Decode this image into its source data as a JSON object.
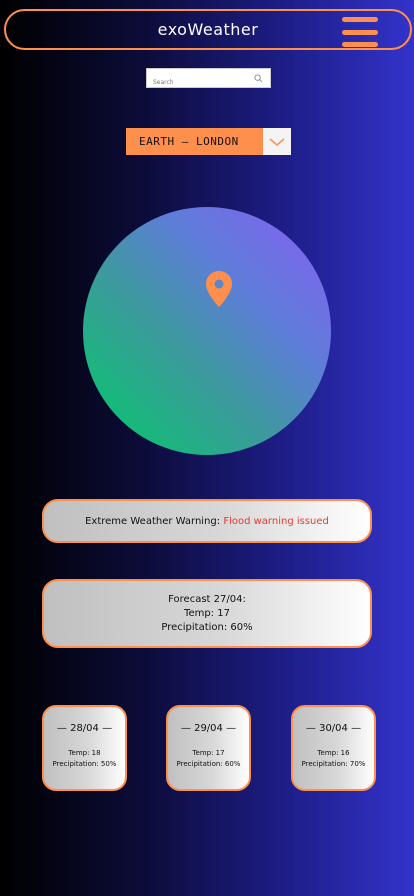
{
  "header": {
    "title": "exoWeather",
    "menu_icon": "hamburger-menu-icon"
  },
  "search": {
    "placeholder": "Search",
    "value": "",
    "icon": "search-icon"
  },
  "location": {
    "selected": "EARTH — LONDON",
    "icon": "chevron-down-icon"
  },
  "map": {
    "icon": "location-pin-icon"
  },
  "warning": {
    "label": "Extreme Weather Warning:",
    "status": "Flood warning issued"
  },
  "forecast": {
    "title": "Forecast 27/04:",
    "temp": "Temp: 17",
    "precip": "Precipitation: 60%"
  },
  "days": [
    {
      "date": "— 28/04 —",
      "temp": "Temp: 18",
      "precip": "Precipitation: 50%"
    },
    {
      "date": "— 29/04 —",
      "temp": "Temp: 17",
      "precip": "Precipitation: 60%"
    },
    {
      "date": "— 30/04 —",
      "temp": "Temp: 16",
      "precip": "Precipitation: 70%"
    }
  ],
  "colors": {
    "accent": "#ff8f4d",
    "warning_text": "#e53935",
    "globe_start": "#00cc66",
    "globe_end": "#8a5cf7"
  }
}
